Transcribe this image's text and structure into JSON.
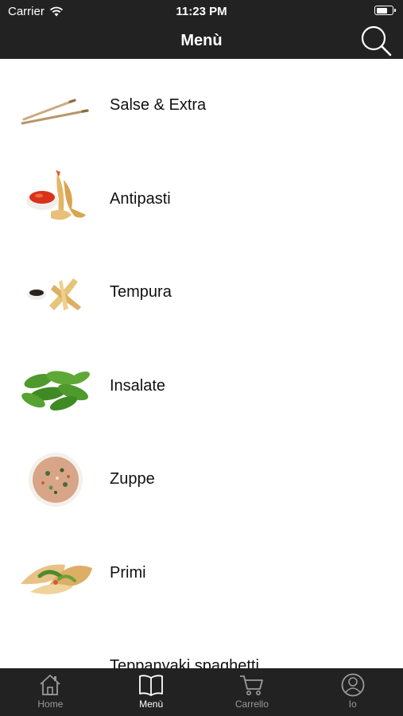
{
  "status_bar": {
    "carrier": "Carrier",
    "time": "11:23 PM",
    "battery_level": 0.75
  },
  "nav": {
    "title": "Menù",
    "search_icon": "search-icon"
  },
  "menu": {
    "items": [
      {
        "label": "Salse & Extra",
        "icon": "chopsticks"
      },
      {
        "label": "Antipasti",
        "icon": "fried-shrimp-with-sauce"
      },
      {
        "label": "Tempura",
        "icon": "tempura-with-soy-sauce"
      },
      {
        "label": "Insalate",
        "icon": "edamame"
      },
      {
        "label": "Zuppe",
        "icon": "soup-bowl"
      },
      {
        "label": "Primi",
        "icon": "fried-dumplings"
      },
      {
        "label": "Teppanyaki spaghetti",
        "icon": "teppanyaki-noodles"
      }
    ]
  },
  "tabs": [
    {
      "label": "Home",
      "icon": "home-icon",
      "active": false
    },
    {
      "label": "Menù",
      "icon": "book-icon",
      "active": true
    },
    {
      "label": "Carrello",
      "icon": "cart-icon",
      "active": false
    },
    {
      "label": "Io",
      "icon": "user-icon",
      "active": false
    }
  ],
  "colors": {
    "bar_background": "#222222",
    "active_tab": "#ffffff",
    "inactive_tab": "#9a9a9a"
  }
}
